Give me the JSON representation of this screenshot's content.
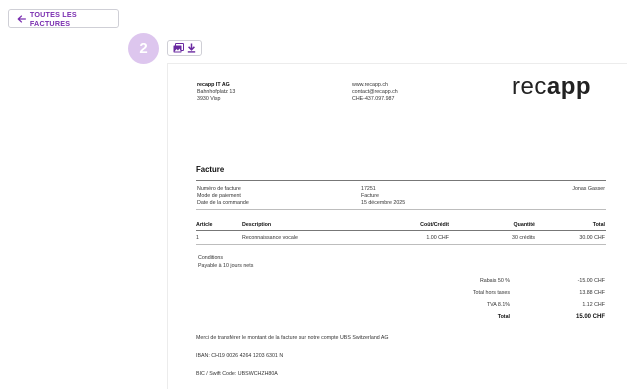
{
  "nav": {
    "back_label": "TOUTES LES FACTURES"
  },
  "step": {
    "number": "2"
  },
  "icons": {
    "back": "arrow-left-icon",
    "image": "image-file-icon",
    "download": "download-icon"
  },
  "colors": {
    "accent": "#7a2fb0",
    "badge": "#ddc6ee"
  },
  "sender": {
    "company": "recapp IT AG",
    "street": "Bahnhofplatz 13",
    "city": "3930 Visp"
  },
  "contact": {
    "web": "www.recapp.ch",
    "email": "contact@recapp.ch",
    "vat": "CHE-437.097.987"
  },
  "logo": {
    "prefix": "rec",
    "suffix": "app"
  },
  "invoice": {
    "title": "Facture",
    "meta": [
      {
        "label": "Numéro de facture",
        "value": "17251",
        "extra": "Jonas Gasser"
      },
      {
        "label": "Mode de paiement",
        "value": "Facture",
        "extra": ""
      },
      {
        "label": "Date de la commande",
        "value": "15 décembre 2025",
        "extra": ""
      }
    ],
    "columns": [
      "Article",
      "Description",
      "Coût/Crédit",
      "Quantité",
      "Total"
    ],
    "rows": [
      {
        "article": "1",
        "description": "Reconnaissance vocale",
        "cost": "1.00 CHF",
        "qty": "30 crédits",
        "total": "30.00 CHF"
      }
    ],
    "conditions_label": "Conditions",
    "conditions_text": "Payable à 10 jours nets",
    "summary": [
      {
        "label": "Rabais 50 %",
        "value": "-15.00 CHF"
      },
      {
        "label": "Total hors taxes",
        "value": "13.88 CHF"
      },
      {
        "label": "TVA 8.1%",
        "value": "1.12 CHF"
      },
      {
        "label": "Total",
        "value": "15.00 CHF"
      }
    ],
    "transfer_note": "Merci de transférer le montant de la facture sur notre compte UBS Switzerland AG",
    "iban": "IBAN: CH19 0026 4264 1203 6301 N",
    "bic": "BIC / Swift Code: UBSWCHZH80A"
  }
}
